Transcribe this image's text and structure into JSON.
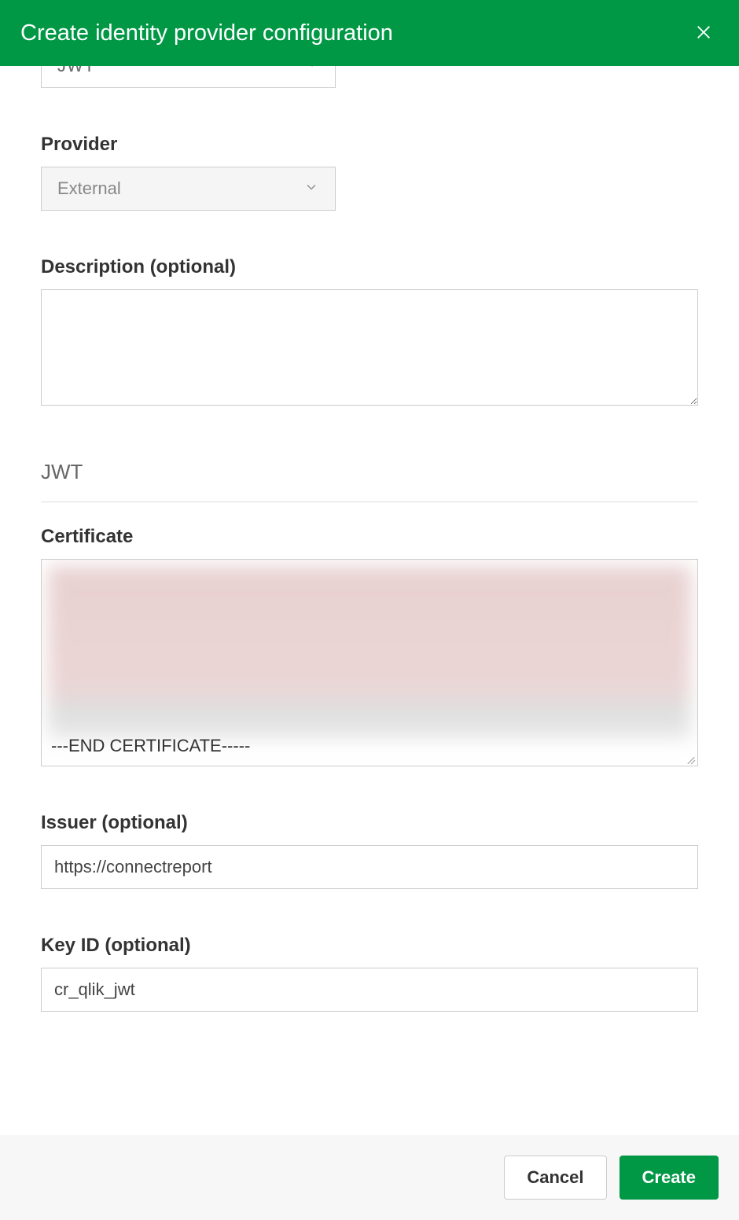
{
  "header": {
    "title": "Create identity provider configuration"
  },
  "fields": {
    "type": {
      "value": "JWT"
    },
    "provider": {
      "label": "Provider",
      "value": "External"
    },
    "description": {
      "label": "Description (optional)",
      "value": ""
    },
    "section_heading": "JWT",
    "certificate": {
      "label": "Certificate",
      "end_marker": "---END CERTIFICATE-----"
    },
    "issuer": {
      "label": "Issuer (optional)",
      "value": "https://connectreport"
    },
    "keyid": {
      "label": "Key ID (optional)",
      "value": "cr_qlik_jwt"
    }
  },
  "footer": {
    "cancel": "Cancel",
    "create": "Create"
  }
}
